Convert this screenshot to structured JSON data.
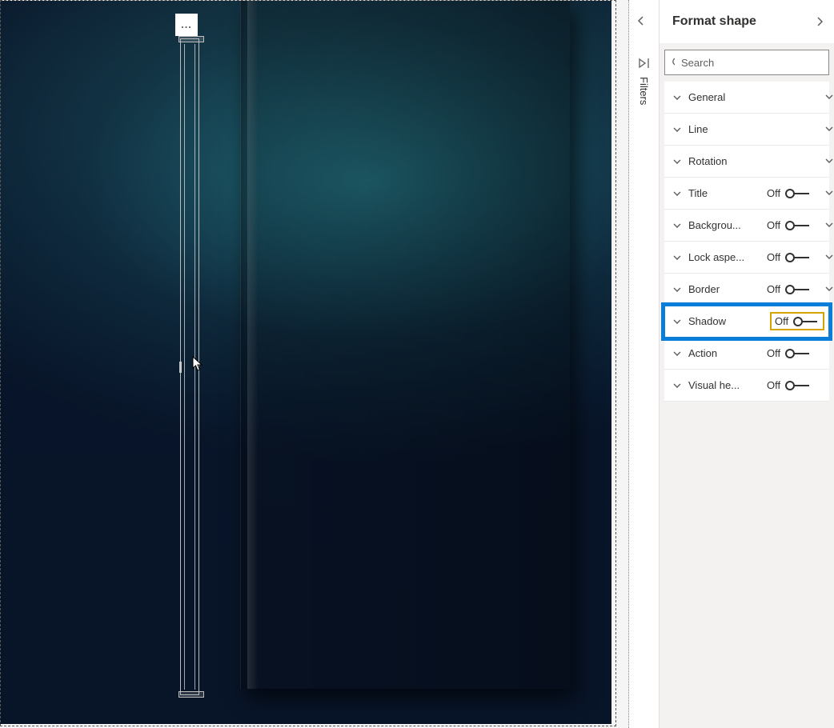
{
  "panel": {
    "title": "Format shape",
    "search_placeholder": "Search"
  },
  "filters_rail": {
    "label": "Filters"
  },
  "properties": [
    {
      "label": "General",
      "hasToggle": false,
      "toggle": ""
    },
    {
      "label": "Line",
      "hasToggle": false,
      "toggle": ""
    },
    {
      "label": "Rotation",
      "hasToggle": false,
      "toggle": ""
    },
    {
      "label": "Title",
      "hasToggle": true,
      "toggle": "Off"
    },
    {
      "label": "Backgrou...",
      "hasToggle": true,
      "toggle": "Off"
    },
    {
      "label": "Lock aspe...",
      "hasToggle": true,
      "toggle": "Off"
    },
    {
      "label": "Border",
      "hasToggle": true,
      "toggle": "Off"
    },
    {
      "label": "Shadow",
      "hasToggle": true,
      "toggle": "Off",
      "highlight": true
    },
    {
      "label": "Action",
      "hasToggle": true,
      "toggle": "Off"
    },
    {
      "label": "Visual he...",
      "hasToggle": true,
      "toggle": "Off"
    }
  ],
  "options_button": "..."
}
